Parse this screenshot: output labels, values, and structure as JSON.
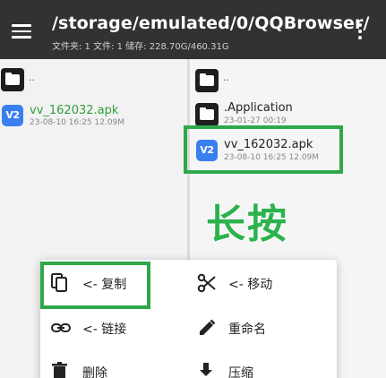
{
  "appbar": {
    "path": "/storage/emulated/0/QQBrowser/",
    "subtitle": "文件夹: 1  文件: 1  储存: 228.70G/460.31G"
  },
  "left_pane": {
    "parent_label": "..",
    "file": {
      "name": "vv_162032.apk",
      "meta": "23-08-10 16:25  12.09M",
      "icon_text": "V2"
    }
  },
  "right_pane": {
    "parent_label": "..",
    "folder": {
      "name": ".Application",
      "meta": "23-01-27 00:19"
    },
    "file": {
      "name": "vv_162032.apk",
      "meta": "23-08-10 16:25  12.09M",
      "icon_text": "V2"
    }
  },
  "annotation": {
    "long_press": "长按"
  },
  "context_menu": {
    "copy": "<- 复制",
    "move": "<- 移动",
    "link": "<- 链接",
    "rename": "重命名",
    "delete": "删除",
    "compress": "压缩"
  },
  "colors": {
    "appbar_bg": "#323232",
    "highlight": "#2ea84a",
    "file_name_green": "#2e9e3e",
    "apk_icon_blue": "#3a7ff0"
  }
}
